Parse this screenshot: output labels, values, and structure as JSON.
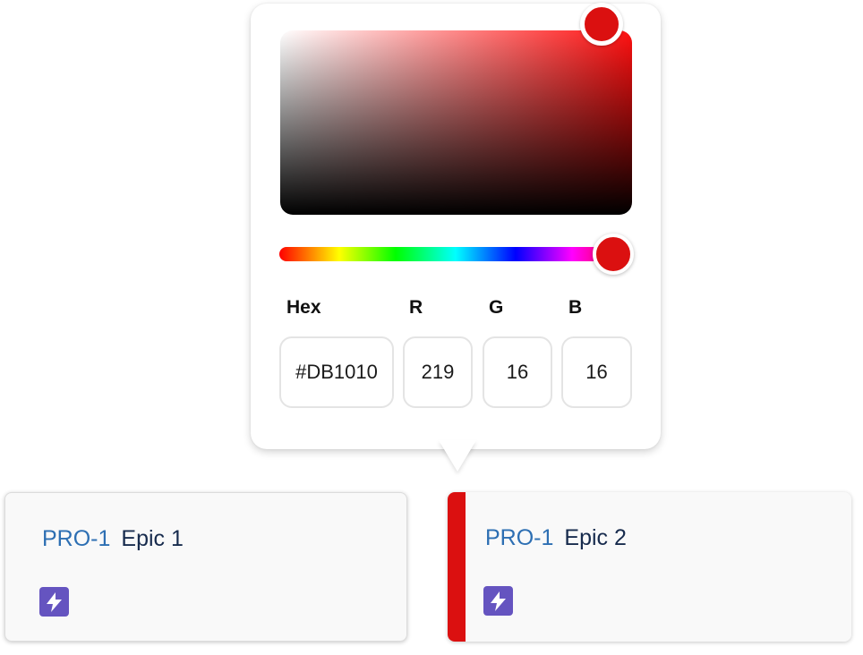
{
  "colors": {
    "selected": "#DB1010",
    "card_key": "#2D6FB3",
    "card_name": "#172B4D",
    "epic_icon_bg": "#6554C0"
  },
  "color_picker": {
    "labels": {
      "hex": "Hex",
      "r": "R",
      "g": "G",
      "b": "B"
    },
    "values": {
      "hex": "#DB1010",
      "r": "219",
      "g": "16",
      "b": "16"
    }
  },
  "cards": [
    {
      "key": "PRO-1",
      "name": "Epic 1",
      "icon": "lightning-icon"
    },
    {
      "key": "PRO-1",
      "name": "Epic 2",
      "icon": "lightning-icon",
      "accent": "#DB1010"
    }
  ]
}
